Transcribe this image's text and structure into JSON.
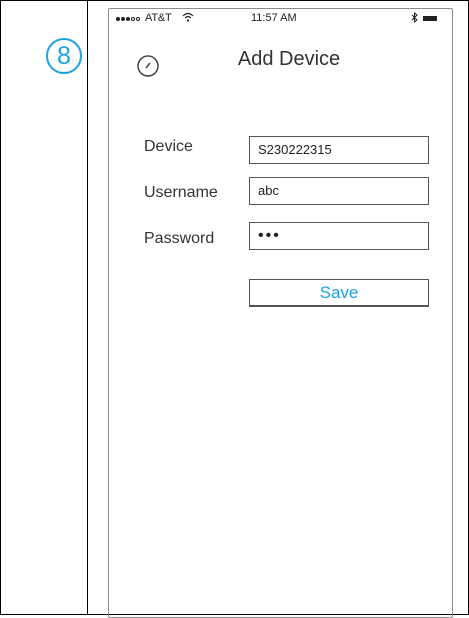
{
  "step": {
    "number": "8"
  },
  "status_bar": {
    "carrier": "AT&T",
    "time": "11:57 AM",
    "signal_icon": "signal-dots-icon",
    "wifi_icon": "wifi-icon",
    "bluetooth_icon": "bluetooth-icon",
    "battery_icon": "battery-icon"
  },
  "nav": {
    "back_icon": "back-icon",
    "title": "Add Device"
  },
  "form": {
    "device": {
      "label": "Device",
      "value": "S230222315"
    },
    "username": {
      "label": "Username",
      "value": "abc"
    },
    "password": {
      "label": "Password",
      "value": "•••"
    }
  },
  "actions": {
    "save_label": "Save"
  },
  "colors": {
    "accent": "#1ea1e1",
    "text": "#333333",
    "border": "#555555"
  }
}
